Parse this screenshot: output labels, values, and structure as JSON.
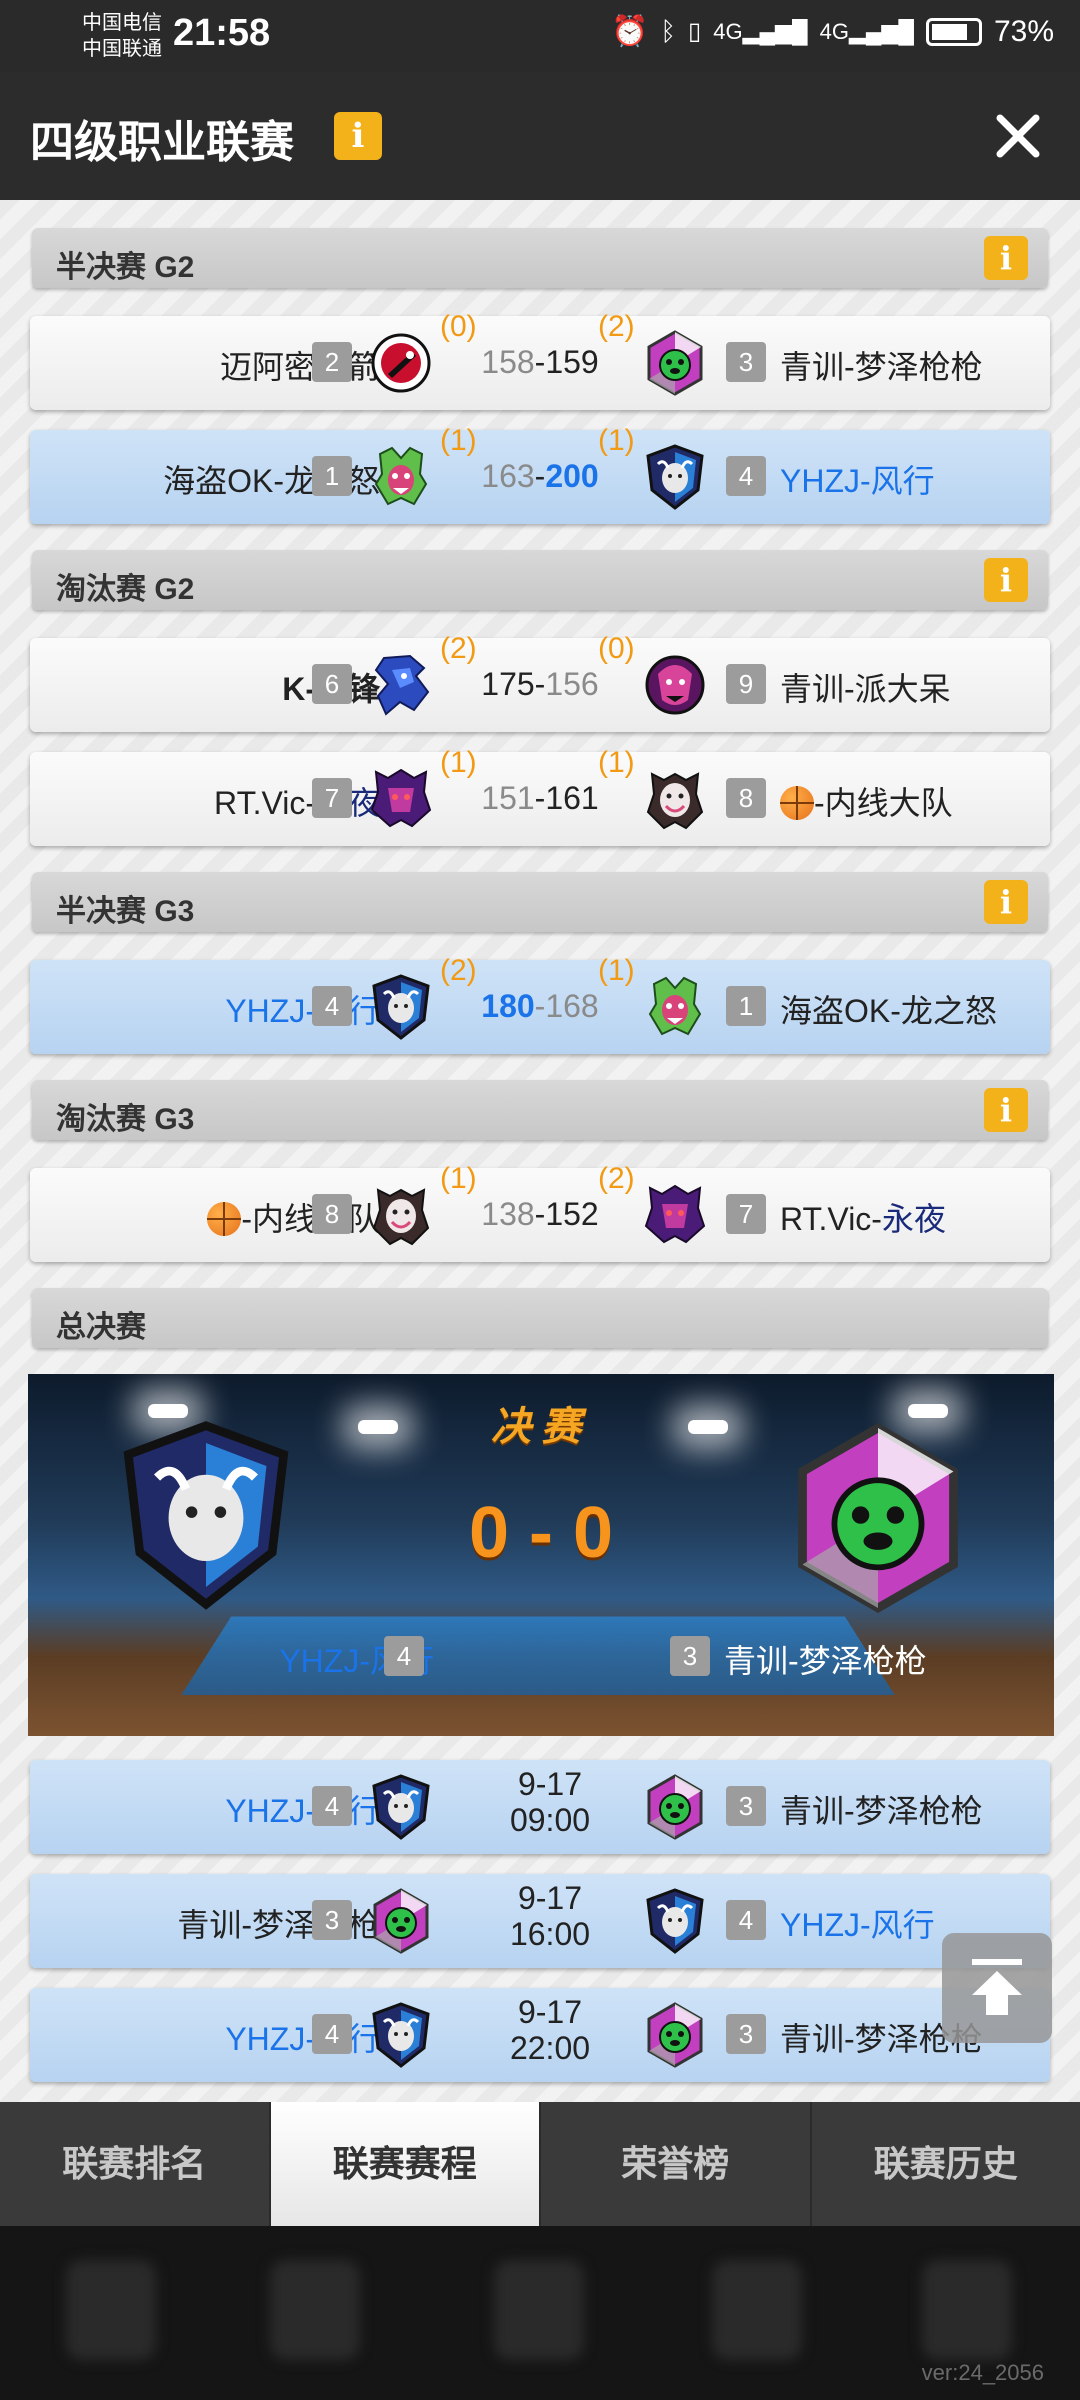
{
  "status_bar": {
    "carrier_1": "中国电信",
    "carrier_2": "中国联通",
    "time": "21:58",
    "battery": "73%",
    "icons": [
      "alarm-icon",
      "bluetooth-icon",
      "vibrate-icon",
      "signal-4g-icon",
      "signal-4g-icon",
      "battery-icon"
    ]
  },
  "header": {
    "title": "四级职业联赛",
    "info_icon": "i"
  },
  "sections": [
    {
      "title": "半决赛 G2",
      "matches": [
        {
          "left_team": "迈阿密火箭",
          "left_seed": "2",
          "left_wins": "(0)",
          "left_score": "158",
          "right_score": "159",
          "right_wins": "(2)",
          "right_seed": "3",
          "right_team": "青训-梦泽枪枪"
        },
        {
          "left_team": "海盗OK-龙之怒",
          "left_seed": "1",
          "left_wins": "(1)",
          "left_score": "163",
          "right_score": "200",
          "right_wins": "(1)",
          "right_seed": "4",
          "right_team": "YHZJ-风行"
        }
      ]
    },
    {
      "title": "淘汰赛 G2",
      "matches": [
        {
          "left_team": "K-冈锋",
          "left_seed": "6",
          "left_wins": "(2)",
          "left_score": "175",
          "right_score": "156",
          "right_wins": "(0)",
          "right_seed": "9",
          "right_team": "青训-派大呆"
        },
        {
          "left_team_a": "RT.Vic-",
          "left_team_b": "永夜",
          "left_seed": "7",
          "left_wins": "(1)",
          "left_score": "151",
          "right_score": "161",
          "right_wins": "(1)",
          "right_seed": "8",
          "right_team": "-内线大队"
        }
      ]
    },
    {
      "title": "半决赛 G3",
      "matches": [
        {
          "left_team": "YHZJ-风行",
          "left_seed": "4",
          "left_wins": "(2)",
          "left_score": "180",
          "right_score": "168",
          "right_wins": "(1)",
          "right_seed": "1",
          "right_team": "海盗OK-龙之怒"
        }
      ]
    },
    {
      "title": "淘汰赛 G3",
      "matches": [
        {
          "left_team": "-内线大队",
          "left_seed": "8",
          "left_wins": "(1)",
          "left_score": "138",
          "right_score": "152",
          "right_wins": "(2)",
          "right_seed": "7",
          "right_team_a": "RT.Vic-",
          "right_team_b": "永夜"
        }
      ]
    },
    {
      "title": "总决赛"
    }
  ],
  "score_separator": "-",
  "final": {
    "banner_title": "决赛",
    "left_wins": "0",
    "separator": "-",
    "right_wins": "0",
    "left_team": "YHZJ-风行",
    "left_seed": "4",
    "right_team": "青训-梦泽枪枪",
    "right_seed": "3"
  },
  "schedule": [
    {
      "left_team": "YHZJ-风行",
      "left_seed": "4",
      "date": "9-17",
      "time": "09:00",
      "right_seed": "3",
      "right_team": "青训-梦泽枪枪"
    },
    {
      "left_team": "青训-梦泽枪枪",
      "left_seed": "3",
      "date": "9-17",
      "time": "16:00",
      "right_seed": "4",
      "right_team": "YHZJ-风行"
    },
    {
      "left_team": "YHZJ-风行",
      "left_seed": "4",
      "date": "9-17",
      "time": "22:00",
      "right_seed": "3",
      "right_team": "青训-梦泽枪枪"
    }
  ],
  "tabs": [
    {
      "label": "联赛排名",
      "active": false
    },
    {
      "label": "联赛赛程",
      "active": true
    },
    {
      "label": "荣誉榜",
      "active": false
    },
    {
      "label": "联赛历史",
      "active": false
    }
  ],
  "version": "ver:24_2056",
  "colors": {
    "accent_blue": "#1a73e8",
    "wins_orange": "#f29a14",
    "info_yellow": "#f3b21a"
  }
}
